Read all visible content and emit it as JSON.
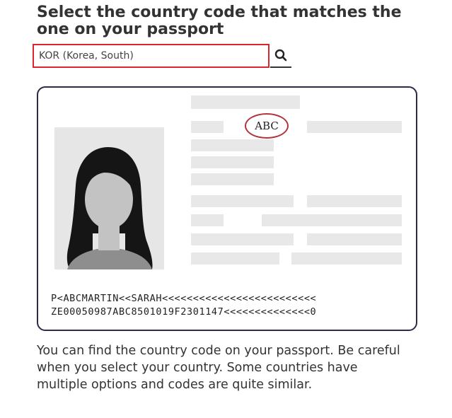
{
  "heading": "Select the country code that matches the one on your passport",
  "country_select": {
    "value": "KOR (Korea, South)",
    "search_icon": "search-icon"
  },
  "passport_sample": {
    "country_code": "ABC",
    "photo": "person-silhouette-icon",
    "mrz_line_1": "P<ABCMARTIN<<SARAH<<<<<<<<<<<<<<<<<<<<<<<<<",
    "mrz_line_2": "ZE00050987ABC8501019F2301147<<<<<<<<<<<<<<0"
  },
  "help_text": "You can find the country code on your passport. Be careful when you select your country. Some countries have multiple options and codes are quite similar.",
  "colors": {
    "highlight_red": "#d9262e",
    "passport_border": "#2e2a4a",
    "placeholder_bar": "#e8e8e8"
  }
}
